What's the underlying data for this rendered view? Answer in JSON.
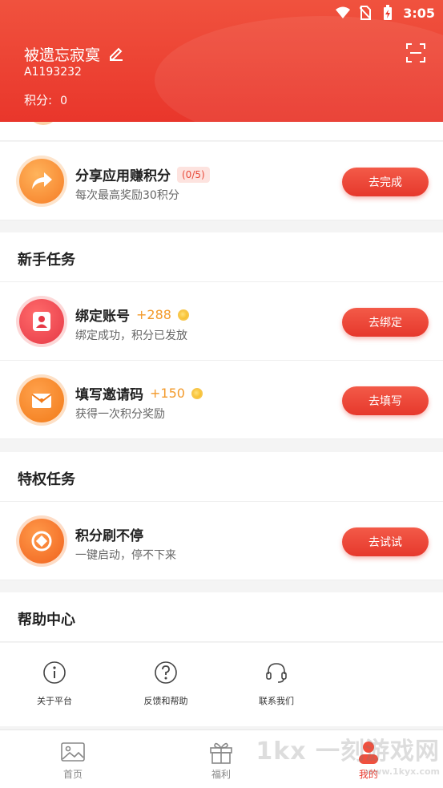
{
  "status_bar": {
    "time": "3:05",
    "icons": [
      "wifi-icon",
      "no-sim-icon",
      "battery-charging-icon"
    ]
  },
  "header": {
    "username": "被遗忘寂寞",
    "user_id": "A1193232",
    "points_label": "积分:",
    "points_value": "0",
    "icons": [
      "edit-icon",
      "scan-icon"
    ]
  },
  "tasks_daily": [
    {
      "title": "分享应用赚积分",
      "badge": "(0/5)",
      "subtitle": "每次最高奖励30积分",
      "button": "去完成",
      "icon": "share-icon"
    }
  ],
  "section_newbie": {
    "title": "新手任务",
    "tasks": [
      {
        "title": "绑定账号",
        "bonus": "+288",
        "subtitle": "绑定成功，积分已发放",
        "button": "去绑定",
        "icon": "user-bind-icon"
      },
      {
        "title": "填写邀请码",
        "bonus": "+150",
        "subtitle": "获得一次积分奖励",
        "button": "去填写",
        "icon": "invite-envelope-icon"
      }
    ]
  },
  "section_privilege": {
    "title": "特权任务",
    "tasks": [
      {
        "title": "积分刷不停",
        "subtitle": "一键启动，停不下来",
        "button": "去试试",
        "icon": "points-refresh-icon"
      }
    ]
  },
  "section_help": {
    "title": "帮助中心",
    "items": [
      {
        "label": "关于平台",
        "icon": "info-icon"
      },
      {
        "label": "反馈和帮助",
        "icon": "question-icon"
      },
      {
        "label": "联系我们",
        "icon": "headset-icon"
      }
    ]
  },
  "bottom_nav": {
    "items": [
      {
        "label": "首页",
        "icon": "home-image-icon",
        "active": false
      },
      {
        "label": "福利",
        "icon": "gift-icon",
        "active": false
      },
      {
        "label": "我的",
        "icon": "profile-icon",
        "active": true
      }
    ]
  },
  "watermark": {
    "text": "1kx 一刻游戏网",
    "url": "www.1kyx.com"
  },
  "colors": {
    "accent": "#e8392d",
    "bonus": "#f39a2b",
    "header": "#ea3b2e"
  }
}
